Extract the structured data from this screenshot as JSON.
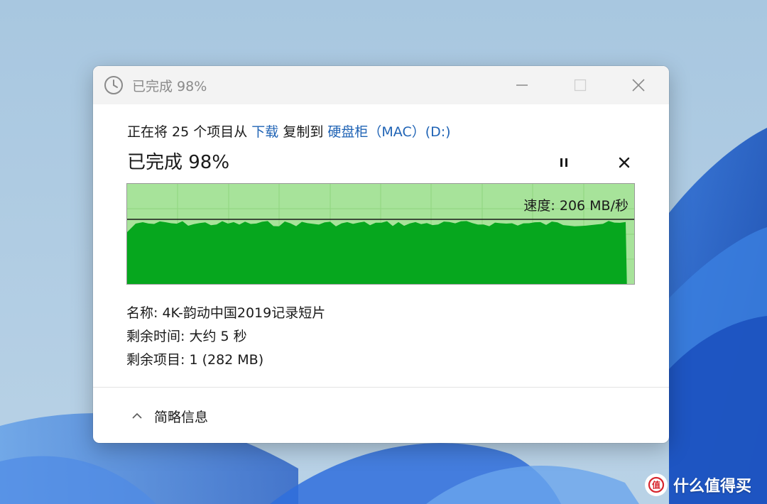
{
  "window": {
    "title": "已完成 98%",
    "icons": {
      "app": "clock-icon",
      "minimize": "minimize-icon",
      "maximize": "maximize-icon",
      "close": "close-icon"
    }
  },
  "copy": {
    "prefix": "正在将 25 个项目从 ",
    "source": "下载",
    "middle": " 复制到 ",
    "destination": "硬盘柜（MAC）(D:)"
  },
  "progress": {
    "title": "已完成 98%",
    "percent": 98,
    "pause_icon": "pause-icon",
    "stop_icon": "close-icon"
  },
  "graph": {
    "speed_label": "速度: 206 MB/秒",
    "current_speed_mb_s": 206,
    "fill_color": "#06a71e",
    "background_color": "#a7e39a",
    "grid_color": "#8fd67f"
  },
  "details": {
    "name": "名称: 4K-韵动中国2019记录短片",
    "time_remaining": "剩余时间: 大约 5 秒",
    "items_remaining": "剩余项目: 1 (282 MB)"
  },
  "footer": {
    "less_info_label": "简略信息",
    "chevron_icon": "chevron-up-icon"
  },
  "watermark": {
    "text": "什么值得买",
    "logo": "smzdm-logo-icon"
  }
}
